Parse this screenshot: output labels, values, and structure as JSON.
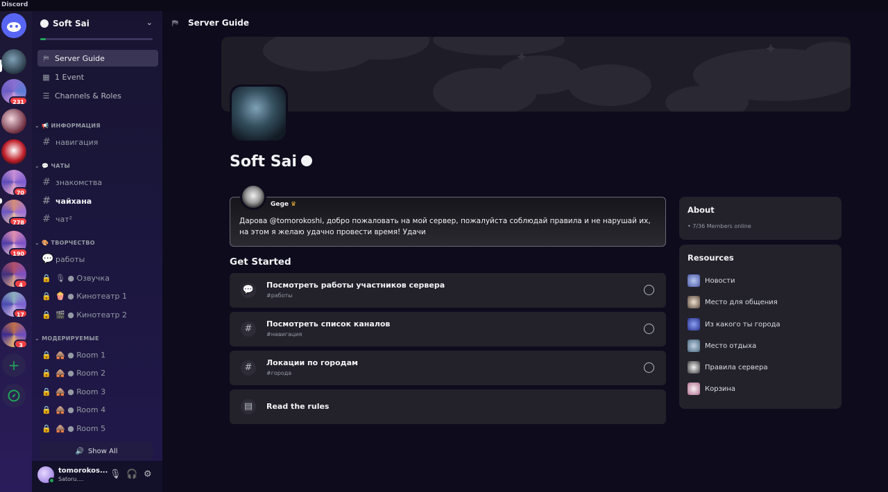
{
  "app_title": "Discord",
  "colors": {
    "accent_green": "#23a55a",
    "badge_red": "#f23f43",
    "crown": "#f0b232"
  },
  "rail": {
    "badges": [
      "231",
      "70",
      "778",
      "190",
      "4",
      "17",
      "3"
    ],
    "add_icon": "plus-icon",
    "explore_icon": "compass-icon"
  },
  "server": {
    "name": "Soft Sai",
    "boost_progress": 0.05
  },
  "nav": {
    "server_guide": "Server Guide",
    "events": "1 Event",
    "channels_roles": "Channels & Roles"
  },
  "categories": [
    {
      "name": "ИНФОРМАЦИЯ",
      "emoji": "📢",
      "channels": [
        {
          "name": "навигация",
          "type": "text"
        }
      ]
    },
    {
      "name": "ЧАТЫ",
      "emoji": "💬",
      "channels": [
        {
          "name": "знакомства",
          "type": "text"
        },
        {
          "name": "чайхана",
          "type": "text",
          "unread": true
        },
        {
          "name": "чат²",
          "type": "text"
        }
      ]
    },
    {
      "name": "ТВОРЧЕСТВО",
      "emoji": "🎨",
      "channels": [
        {
          "name": "работы",
          "type": "forum"
        },
        {
          "name": "🎙 ● Озвучка",
          "type": "voice-locked"
        },
        {
          "name": "🍿 ● Кинотеатр 1",
          "type": "voice-locked"
        },
        {
          "name": "🎬 ● Кинотеатр 2",
          "type": "voice-locked"
        }
      ]
    },
    {
      "name": "МОДЕРИРУЕМЫЕ",
      "emoji": "",
      "channels": [
        {
          "name": "🛖 ● Room 1",
          "type": "voice-locked"
        },
        {
          "name": "🛖 ● Room 2",
          "type": "voice-locked"
        },
        {
          "name": "🛖 ● Room 3",
          "type": "voice-locked"
        },
        {
          "name": "🛖 ● Room 4",
          "type": "voice-locked"
        },
        {
          "name": "🛖 ● Room 5",
          "type": "voice-locked"
        }
      ]
    }
  ],
  "show_all": "Show All",
  "user": {
    "name": "tomorokos...",
    "status": "Satoru...."
  },
  "main": {
    "header_title": "Server Guide",
    "server_title": "Soft Sai",
    "welcome": {
      "author": "Gege",
      "message": "Дарова @tomorokoshi, добро пожаловать на мой сервер, пожалуйста соблюдай правила и не нарушай их, на этом я желаю удачно провести время! Удачи"
    },
    "get_started": "Get Started",
    "tasks": [
      {
        "title": "Посмотреть работы участников сервера",
        "channel": "#работы",
        "icon": "forum-icon"
      },
      {
        "title": "Посмотреть список каналов",
        "channel": "#навигация",
        "icon": "hash-icon"
      },
      {
        "title": "Локации по городам",
        "channel": "#города",
        "icon": "hash-icon"
      },
      {
        "title": "Read the rules",
        "channel": "",
        "icon": "rules-icon"
      }
    ],
    "about": {
      "title": "About",
      "members": "• 7/36 Members online"
    },
    "resources": {
      "title": "Resources",
      "items": [
        "Новости",
        "Место для общения",
        "Из какого ты города",
        "Место отдыха",
        "Правила сервера",
        "Корзина"
      ]
    }
  }
}
